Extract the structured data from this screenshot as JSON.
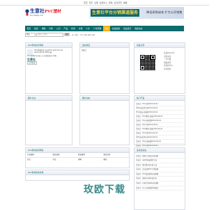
{
  "topbar": {
    "links": [
      "首页",
      "登录",
      "注册",
      "会员中心",
      "帮助",
      "设为首页",
      "收藏"
    ]
  },
  "logo": {
    "name_cn": "生意社",
    "name_pvc": "PVC塑材",
    "tagline": "Pvc.100ppi.com"
  },
  "banner": {
    "headline": "生意社平台分销渠道服务",
    "subline": "降低采购成本 扩大公司销售"
  },
  "nav": {
    "items": [
      "首页",
      "供应",
      "求购",
      "行情",
      "公司",
      "产品",
      "新闻",
      "文章",
      "人才",
      "广告管理",
      "展会",
      "商品快报",
      "商品目录",
      "展会动态",
      "会员中心"
    ]
  },
  "search": {
    "select_value": "供应",
    "placeholder": "请输入关键字",
    "button": "搜索",
    "hint": "热门搜索：PVC 塑胶 塑料 管材"
  },
  "news_panel": {
    "title": "PVC塑材商务导航",
    "items": [
      "PVC塑材商务 会员PVC 2024-05-30",
      "2024-06-01 PVC价格",
      "PVC塑材行业 加工工艺动态信息 行情...",
      "生意社"
    ],
    "tag": "公司名录"
  },
  "supply_panel": {
    "title": "最新供应",
    "items": [
      "[供应]"
    ]
  },
  "shop_panel": {
    "title": "商品订阅",
    "lines": [
      "生意社公众号",
      "扫码关注",
      "一手行情",
      "领取资讯",
      "生意社PVC",
      "关注更多"
    ]
  },
  "hot_panel": {
    "title": "热门产品",
    "items": [
      "生意社：PVC行情2024-06-01",
      "LPE价格走势分析2024-06-01",
      "PVC商品价格涨跌2024-06-01",
      "生意社：PVC期货价格表2024-06-01",
      "生意社：PVC价格指数2024-06-01",
      "生意社：PVC行情2024-06-01",
      "生意社：PVC期货价格表2024-06-01",
      "生意社：PVC行情2024-06-01",
      "LPE价格走势分析2024-06-01",
      "生意社：PVC价格指数2024-06-01",
      "生意社：PVC行情2024-06-01"
    ]
  },
  "left_panel_2": {
    "title": "图片企业"
  },
  "mid_panel_2": {
    "title": "图片动态"
  },
  "trade_panel": {
    "title": "PVC塑材商机导航",
    "headers": [
      "产品编码",
      "新品首发",
      "新品推荐",
      "新品评分"
    ],
    "row2": [
      "综合",
      "产品",
      "求购",
      "供应"
    ]
  },
  "cat_panel": {
    "title": "PVC塑材各地市场"
  },
  "feedback_panel": {
    "title": "生意社动态",
    "items": [
      "生意社：铁路大宗商品价格涨跌",
      "生意社：布伦特原油期货大涨",
      "生意社：聚乙烯市场价格上涨",
      "生意社：会议纪要PVC行情指数",
      "生意社：PVC商品期货价格观察",
      "生意社：氯碱行业基本面分析",
      "生意社：石化企业原料价格调整",
      "生意社：化工价格指数本周报告"
    ]
  },
  "watermark": "玫欧下载"
}
